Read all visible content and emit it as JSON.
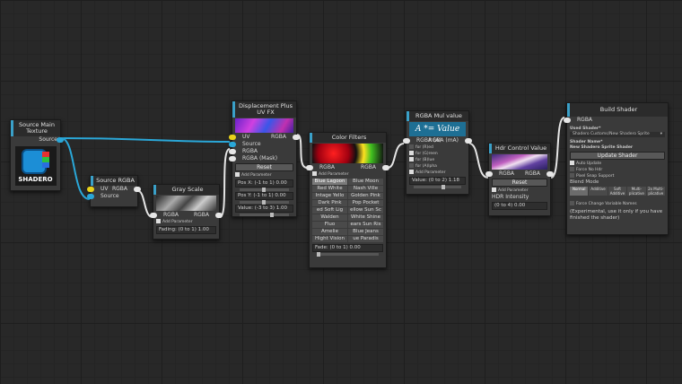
{
  "nodes": {
    "source_main": {
      "title": "Source Main Texture",
      "out_label": "Source",
      "logo_text": "SHADERO"
    },
    "source_rgba": {
      "title": "Source RGBA",
      "uv_label": "UV",
      "rgba_label": "RGBA",
      "source_label": "Source"
    },
    "gray_scale": {
      "title": "Gray Scale",
      "rgba_in": "RGBA",
      "rgba_out": "RGBA",
      "add_param": "Add Parameter",
      "fade": "Fading: (0 to 1) 1.00"
    },
    "displacement": {
      "title": "Displacement Plus UV FX",
      "uv": "UV",
      "rgba_out": "RGBA",
      "source": "Source",
      "rgba": "RGBA",
      "rgba_mask": "RGBA (Mask)",
      "reset": "Reset",
      "add_param": "Add Parameter",
      "pos_x": "Pos X: (-1 to 1) 0.00",
      "pos_y": "Pos Y: (-1 to 1) 0.00",
      "value": "Value: (-3 to 3) 1.00"
    },
    "color_filters": {
      "title": "Color Filters",
      "rgba_in": "RGBA",
      "rgba_out": "RGBA",
      "add_param": "Add Parameter",
      "filters": [
        "Blue Lagoon",
        "Blue Moon",
        "Red White",
        "Nash Ville",
        "Intage Yello",
        "Golden Pink",
        "Dark Pink",
        "Pop Pocket",
        "ed Soft Lig",
        "ellow Sun Sc",
        "Walden",
        "White Shine",
        "Fluo",
        "ears Sun Ris",
        "Amelie",
        "Blue Jeans",
        "Hight Vision",
        "ue Paradis"
      ],
      "fade": "Fade: (0 to 1) 0.00"
    },
    "rgba_mul": {
      "title": "RGBA Mul value",
      "formula": "A *= Value",
      "in_label": "RGBA (A)",
      "out_label": "RGBA (mA)",
      "checks": [
        "for (R)ed",
        "for (G)reen",
        "for (B)lue",
        "for (A)lpha",
        "Add Parameter"
      ],
      "value": "Value: (0 to 2) 1.18"
    },
    "hdr": {
      "title": "Hdr Control Value",
      "rgba_in": "RGBA",
      "rgba_out": "RGBA",
      "reset": "Reset",
      "add_param": "Add Parameter",
      "label": "HDR Intensity",
      "value": "(0 to 4) 0.00"
    },
    "build": {
      "title": "Build Shader",
      "rgba_in": "RGBA",
      "used_label": "Used Shader*",
      "used_value": "Shadero Customs/New Shadero Sprite",
      "used_arrow": "▾",
      "name_label": "Shader Name*",
      "name_value": "New Shadero Sprite Shader",
      "update": "Update Shader",
      "auto_update": "Auto Update",
      "force_no_hdr": "Force No Hdr",
      "pixel_snap": "Pixel Snap Support",
      "blend_label": "Blend Mode",
      "blend_modes": [
        "Normal",
        "Additive",
        "Soft Additive",
        "Multi-plicative",
        "2x Multi-plicative"
      ],
      "force_var": "Force Change Variable Names",
      "note": "(Experimental, use it only if you have finished the shader)"
    }
  },
  "colors": {
    "accent": "#3aa0c8",
    "port_yellow": "#e8d21a",
    "port_blue": "#2aa7d8",
    "mul_bg": "#1e6f94"
  }
}
